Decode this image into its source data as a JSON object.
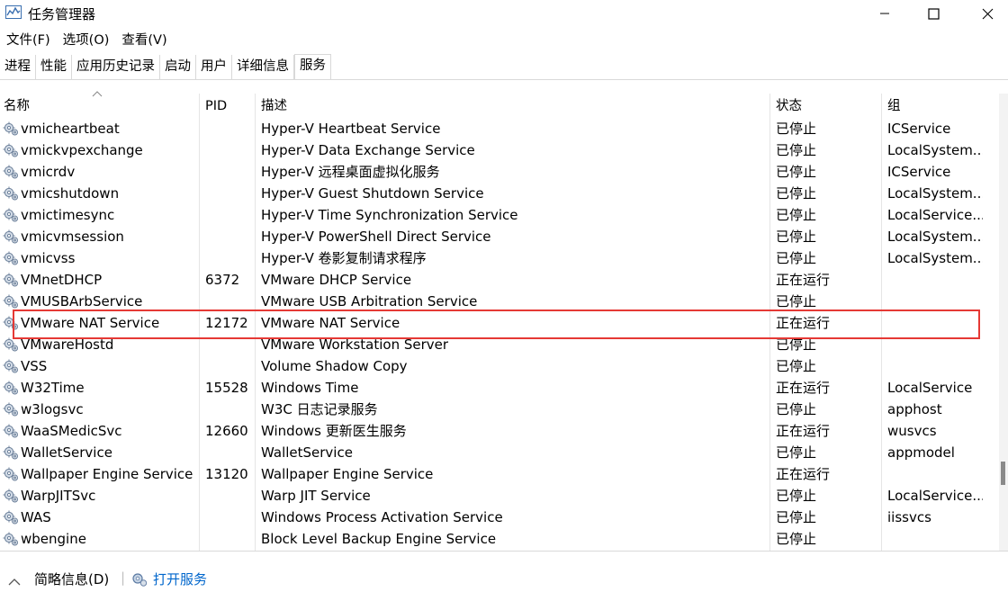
{
  "window": {
    "title": "任务管理器",
    "icons": {
      "app": "task-manager-icon",
      "minimize": "minimize-icon",
      "maximize": "maximize-icon",
      "close": "close-icon"
    }
  },
  "menu": [
    "文件(F)",
    "选项(O)",
    "查看(V)"
  ],
  "tabs": [
    "进程",
    "性能",
    "应用历史记录",
    "启动",
    "用户",
    "详细信息",
    "服务"
  ],
  "active_tab": "服务",
  "columns": {
    "name": "名称",
    "pid": "PID",
    "description": "描述",
    "status": "状态",
    "group": "组"
  },
  "sort": {
    "column": "名称",
    "direction": "ascending",
    "icon": "sort-up-icon"
  },
  "rows": [
    {
      "name": "vmicheartbeat",
      "pid": "",
      "description": "Hyper-V Heartbeat Service",
      "status": "已停止",
      "group": "ICService"
    },
    {
      "name": "vmickvpexchange",
      "pid": "",
      "description": "Hyper-V Data Exchange Service",
      "status": "已停止",
      "group": "LocalSystem..."
    },
    {
      "name": "vmicrdv",
      "pid": "",
      "description": "Hyper-V 远程桌面虚拟化服务",
      "status": "已停止",
      "group": "ICService"
    },
    {
      "name": "vmicshutdown",
      "pid": "",
      "description": "Hyper-V Guest Shutdown Service",
      "status": "已停止",
      "group": "LocalSystem..."
    },
    {
      "name": "vmictimesync",
      "pid": "",
      "description": "Hyper-V Time Synchronization Service",
      "status": "已停止",
      "group": "LocalService..."
    },
    {
      "name": "vmicvmsession",
      "pid": "",
      "description": "Hyper-V PowerShell Direct Service",
      "status": "已停止",
      "group": "LocalSystem..."
    },
    {
      "name": "vmicvss",
      "pid": "",
      "description": "Hyper-V 卷影复制请求程序",
      "status": "已停止",
      "group": "LocalSystem..."
    },
    {
      "name": "VMnetDHCP",
      "pid": "6372",
      "description": "VMware DHCP Service",
      "status": "正在运行",
      "group": ""
    },
    {
      "name": "VMUSBArbService",
      "pid": "",
      "description": "VMware USB Arbitration Service",
      "status": "已停止",
      "group": ""
    },
    {
      "name": "VMware NAT Service",
      "pid": "12172",
      "description": "VMware NAT Service",
      "status": "正在运行",
      "group": ""
    },
    {
      "name": "VMwareHostd",
      "pid": "",
      "description": "VMware Workstation Server",
      "status": "已停止",
      "group": ""
    },
    {
      "name": "VSS",
      "pid": "",
      "description": "Volume Shadow Copy",
      "status": "已停止",
      "group": ""
    },
    {
      "name": "W32Time",
      "pid": "15528",
      "description": "Windows Time",
      "status": "正在运行",
      "group": "LocalService"
    },
    {
      "name": "w3logsvc",
      "pid": "",
      "description": "W3C 日志记录服务",
      "status": "已停止",
      "group": "apphost"
    },
    {
      "name": "WaaSMedicSvc",
      "pid": "12660",
      "description": "Windows 更新医生服务",
      "status": "正在运行",
      "group": "wusvcs"
    },
    {
      "name": "WalletService",
      "pid": "",
      "description": "WalletService",
      "status": "已停止",
      "group": "appmodel"
    },
    {
      "name": "Wallpaper Engine Service",
      "pid": "13120",
      "description": "Wallpaper Engine Service",
      "status": "正在运行",
      "group": ""
    },
    {
      "name": "WarpJITSvc",
      "pid": "",
      "description": "Warp JIT Service",
      "status": "已停止",
      "group": "LocalService..."
    },
    {
      "name": "WAS",
      "pid": "",
      "description": "Windows Process Activation Service",
      "status": "已停止",
      "group": "iissvcs"
    },
    {
      "name": "wbengine",
      "pid": "",
      "description": "Block Level Backup Engine Service",
      "status": "已停止",
      "group": ""
    }
  ],
  "row_icon": "service-gear-icon",
  "highlight_color": "#e53935",
  "footer": {
    "brief_info": "简略信息(D)",
    "brief_icon": "chevron-up-icon",
    "open_services": "打开服务",
    "open_services_icon": "services-gear-icon",
    "link_color": "#0066cc"
  }
}
